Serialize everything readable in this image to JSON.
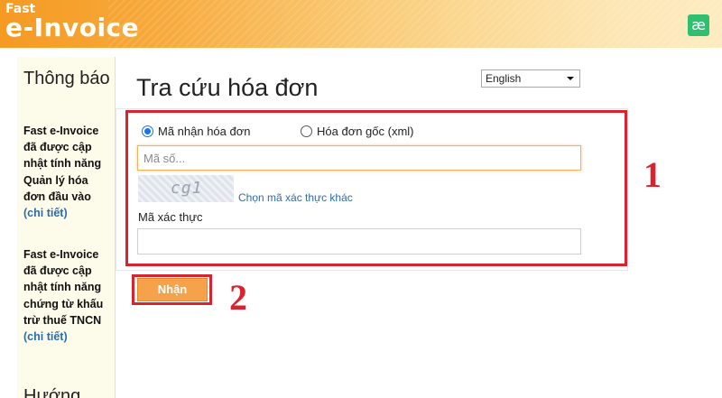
{
  "header": {
    "logo_top": "Fast",
    "logo_main": "e-Invoice",
    "right_button": "æ"
  },
  "sidebar": {
    "title": "Thông báo",
    "news": [
      {
        "text": "Fast e-Invoice đã được cập nhật tính năng Quản lý hóa đơn đầu vào ",
        "link": "(chi tiết)"
      },
      {
        "text": "Fast e-Invoice đã được cập nhật tính năng chứng từ khấu trừ thuế TNCN ",
        "link": "(chi tiết)"
      }
    ],
    "next_section": "Hướng"
  },
  "main": {
    "title": "Tra cứu hóa đơn",
    "language": {
      "selected": "English"
    },
    "radios": [
      {
        "label": "Mã nhận hóa đơn",
        "checked": true
      },
      {
        "label": "Hóa đơn gốc (xml)",
        "checked": false
      }
    ],
    "code_input": {
      "placeholder": "Mã số...",
      "value": ""
    },
    "captcha": {
      "text": "cg1",
      "refresh_link": "Chọn mã xác thực khác"
    },
    "verify": {
      "label": "Mã xác thực",
      "value": ""
    },
    "submit_label": "Nhận"
  },
  "annotations": {
    "marker1": "1",
    "marker2": "2",
    "color": "#d9232e"
  },
  "colors": {
    "accent": "#f5a24a",
    "link": "#2a6db0",
    "radio": "#1a73e8"
  }
}
